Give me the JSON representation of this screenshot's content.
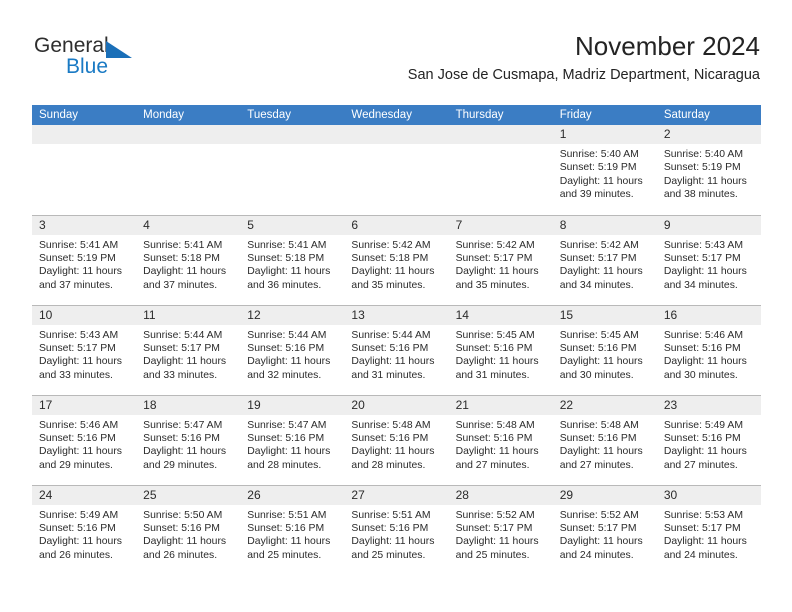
{
  "brand": {
    "name_part1": "General",
    "name_part2": "Blue",
    "triangle_color": "#1a6fb8",
    "blue_color": "#1a7ac4"
  },
  "header": {
    "title": "November 2024",
    "subtitle": "San Jose de Cusmapa, Madriz Department, Nicaragua"
  },
  "theme": {
    "header_row_bg": "#3b7dc4",
    "day_number_bg": "#eeeeee",
    "grid_line": "#b9b9b9",
    "text": "#2b2b2b"
  },
  "calendar": {
    "weekdays": [
      "Sunday",
      "Monday",
      "Tuesday",
      "Wednesday",
      "Thursday",
      "Friday",
      "Saturday"
    ],
    "weeks": [
      [
        {
          "day": "",
          "empty": true
        },
        {
          "day": "",
          "empty": true
        },
        {
          "day": "",
          "empty": true
        },
        {
          "day": "",
          "empty": true
        },
        {
          "day": "",
          "empty": true
        },
        {
          "day": "1",
          "sunrise": "Sunrise: 5:40 AM",
          "sunset": "Sunset: 5:19 PM",
          "daylight1": "Daylight: 11 hours",
          "daylight2": "and 39 minutes."
        },
        {
          "day": "2",
          "sunrise": "Sunrise: 5:40 AM",
          "sunset": "Sunset: 5:19 PM",
          "daylight1": "Daylight: 11 hours",
          "daylight2": "and 38 minutes."
        }
      ],
      [
        {
          "day": "3",
          "sunrise": "Sunrise: 5:41 AM",
          "sunset": "Sunset: 5:19 PM",
          "daylight1": "Daylight: 11 hours",
          "daylight2": "and 37 minutes."
        },
        {
          "day": "4",
          "sunrise": "Sunrise: 5:41 AM",
          "sunset": "Sunset: 5:18 PM",
          "daylight1": "Daylight: 11 hours",
          "daylight2": "and 37 minutes."
        },
        {
          "day": "5",
          "sunrise": "Sunrise: 5:41 AM",
          "sunset": "Sunset: 5:18 PM",
          "daylight1": "Daylight: 11 hours",
          "daylight2": "and 36 minutes."
        },
        {
          "day": "6",
          "sunrise": "Sunrise: 5:42 AM",
          "sunset": "Sunset: 5:18 PM",
          "daylight1": "Daylight: 11 hours",
          "daylight2": "and 35 minutes."
        },
        {
          "day": "7",
          "sunrise": "Sunrise: 5:42 AM",
          "sunset": "Sunset: 5:17 PM",
          "daylight1": "Daylight: 11 hours",
          "daylight2": "and 35 minutes."
        },
        {
          "day": "8",
          "sunrise": "Sunrise: 5:42 AM",
          "sunset": "Sunset: 5:17 PM",
          "daylight1": "Daylight: 11 hours",
          "daylight2": "and 34 minutes."
        },
        {
          "day": "9",
          "sunrise": "Sunrise: 5:43 AM",
          "sunset": "Sunset: 5:17 PM",
          "daylight1": "Daylight: 11 hours",
          "daylight2": "and 34 minutes."
        }
      ],
      [
        {
          "day": "10",
          "sunrise": "Sunrise: 5:43 AM",
          "sunset": "Sunset: 5:17 PM",
          "daylight1": "Daylight: 11 hours",
          "daylight2": "and 33 minutes."
        },
        {
          "day": "11",
          "sunrise": "Sunrise: 5:44 AM",
          "sunset": "Sunset: 5:17 PM",
          "daylight1": "Daylight: 11 hours",
          "daylight2": "and 33 minutes."
        },
        {
          "day": "12",
          "sunrise": "Sunrise: 5:44 AM",
          "sunset": "Sunset: 5:16 PM",
          "daylight1": "Daylight: 11 hours",
          "daylight2": "and 32 minutes."
        },
        {
          "day": "13",
          "sunrise": "Sunrise: 5:44 AM",
          "sunset": "Sunset: 5:16 PM",
          "daylight1": "Daylight: 11 hours",
          "daylight2": "and 31 minutes."
        },
        {
          "day": "14",
          "sunrise": "Sunrise: 5:45 AM",
          "sunset": "Sunset: 5:16 PM",
          "daylight1": "Daylight: 11 hours",
          "daylight2": "and 31 minutes."
        },
        {
          "day": "15",
          "sunrise": "Sunrise: 5:45 AM",
          "sunset": "Sunset: 5:16 PM",
          "daylight1": "Daylight: 11 hours",
          "daylight2": "and 30 minutes."
        },
        {
          "day": "16",
          "sunrise": "Sunrise: 5:46 AM",
          "sunset": "Sunset: 5:16 PM",
          "daylight1": "Daylight: 11 hours",
          "daylight2": "and 30 minutes."
        }
      ],
      [
        {
          "day": "17",
          "sunrise": "Sunrise: 5:46 AM",
          "sunset": "Sunset: 5:16 PM",
          "daylight1": "Daylight: 11 hours",
          "daylight2": "and 29 minutes."
        },
        {
          "day": "18",
          "sunrise": "Sunrise: 5:47 AM",
          "sunset": "Sunset: 5:16 PM",
          "daylight1": "Daylight: 11 hours",
          "daylight2": "and 29 minutes."
        },
        {
          "day": "19",
          "sunrise": "Sunrise: 5:47 AM",
          "sunset": "Sunset: 5:16 PM",
          "daylight1": "Daylight: 11 hours",
          "daylight2": "and 28 minutes."
        },
        {
          "day": "20",
          "sunrise": "Sunrise: 5:48 AM",
          "sunset": "Sunset: 5:16 PM",
          "daylight1": "Daylight: 11 hours",
          "daylight2": "and 28 minutes."
        },
        {
          "day": "21",
          "sunrise": "Sunrise: 5:48 AM",
          "sunset": "Sunset: 5:16 PM",
          "daylight1": "Daylight: 11 hours",
          "daylight2": "and 27 minutes."
        },
        {
          "day": "22",
          "sunrise": "Sunrise: 5:48 AM",
          "sunset": "Sunset: 5:16 PM",
          "daylight1": "Daylight: 11 hours",
          "daylight2": "and 27 minutes."
        },
        {
          "day": "23",
          "sunrise": "Sunrise: 5:49 AM",
          "sunset": "Sunset: 5:16 PM",
          "daylight1": "Daylight: 11 hours",
          "daylight2": "and 27 minutes."
        }
      ],
      [
        {
          "day": "24",
          "sunrise": "Sunrise: 5:49 AM",
          "sunset": "Sunset: 5:16 PM",
          "daylight1": "Daylight: 11 hours",
          "daylight2": "and 26 minutes."
        },
        {
          "day": "25",
          "sunrise": "Sunrise: 5:50 AM",
          "sunset": "Sunset: 5:16 PM",
          "daylight1": "Daylight: 11 hours",
          "daylight2": "and 26 minutes."
        },
        {
          "day": "26",
          "sunrise": "Sunrise: 5:51 AM",
          "sunset": "Sunset: 5:16 PM",
          "daylight1": "Daylight: 11 hours",
          "daylight2": "and 25 minutes."
        },
        {
          "day": "27",
          "sunrise": "Sunrise: 5:51 AM",
          "sunset": "Sunset: 5:16 PM",
          "daylight1": "Daylight: 11 hours",
          "daylight2": "and 25 minutes."
        },
        {
          "day": "28",
          "sunrise": "Sunrise: 5:52 AM",
          "sunset": "Sunset: 5:17 PM",
          "daylight1": "Daylight: 11 hours",
          "daylight2": "and 25 minutes."
        },
        {
          "day": "29",
          "sunrise": "Sunrise: 5:52 AM",
          "sunset": "Sunset: 5:17 PM",
          "daylight1": "Daylight: 11 hours",
          "daylight2": "and 24 minutes."
        },
        {
          "day": "30",
          "sunrise": "Sunrise: 5:53 AM",
          "sunset": "Sunset: 5:17 PM",
          "daylight1": "Daylight: 11 hours",
          "daylight2": "and 24 minutes."
        }
      ]
    ]
  }
}
